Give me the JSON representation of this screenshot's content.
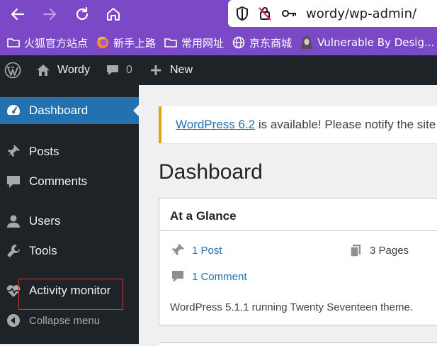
{
  "browser": {
    "url": "wordy/wp-admin/",
    "bookmarks": [
      {
        "label": "火狐官方站点",
        "icon": "folder-icon"
      },
      {
        "label": "新手上路",
        "icon": "firefox-icon"
      },
      {
        "label": "常用网址",
        "icon": "folder-icon"
      },
      {
        "label": "京东商城",
        "icon": "globe-icon"
      },
      {
        "label": "Vulnerable By Desig...",
        "icon": "hacker-icon"
      }
    ],
    "accent": "#7b48c6"
  },
  "adminbar": {
    "site_name": "Wordy",
    "comments_count": "0",
    "new_label": "New"
  },
  "sidebar": {
    "items": [
      {
        "label": "Dashboard",
        "icon": "dashboard-icon",
        "active": true
      },
      {
        "label": "Posts",
        "icon": "pushpin-icon"
      },
      {
        "label": "Comments",
        "icon": "comment-icon"
      },
      {
        "label": "Users",
        "icon": "user-icon"
      },
      {
        "label": "Tools",
        "icon": "wrench-icon"
      },
      {
        "label": "Activity monitor",
        "icon": "heartbeat-icon"
      },
      {
        "label": "Collapse menu",
        "icon": "collapse-icon"
      }
    ],
    "active_color": "#2271b1"
  },
  "notice": {
    "link": "WordPress 6.2",
    "text": " is available! Please notify the site"
  },
  "main": {
    "title": "Dashboard",
    "glance": {
      "title": "At a Glance",
      "post": "1 Post",
      "pages": "3 Pages",
      "comment": "1 Comment",
      "footer": "WordPress 5.1.1 running Twenty Seventeen theme."
    }
  }
}
